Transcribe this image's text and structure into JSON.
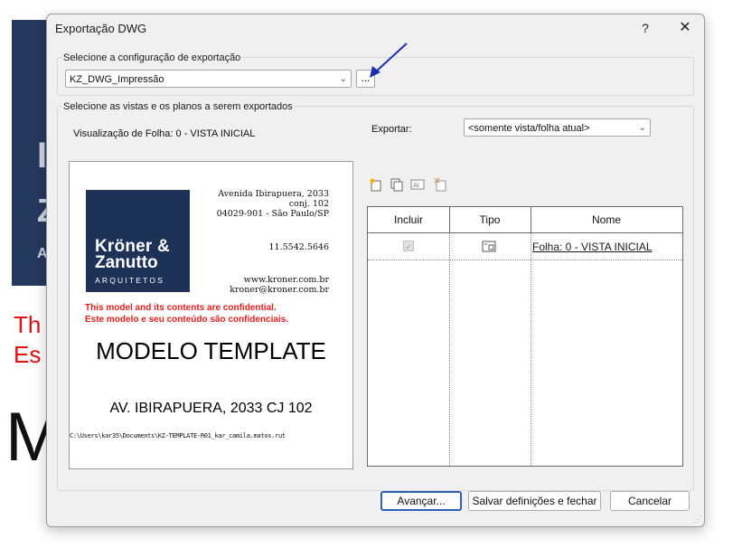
{
  "background": {
    "ghost_letters": [
      "I",
      "Z",
      "A"
    ],
    "red_line1": "Th",
    "red_line2": "Es",
    "big_letter": "M"
  },
  "dialog": {
    "title": "Exportação DWG",
    "help": "?",
    "close": "✕"
  },
  "export_config": {
    "group_label": "Selecione a configuração de exportação",
    "selected": "KZ_DWG_Impressão",
    "more_button": "..."
  },
  "views": {
    "group_label": "Selecione as vistas e os planos a serem exportados",
    "sheet_view_label": "Visualização de Folha: 0 - VISTA INICIAL",
    "export_label": "Exportar:",
    "export_selected": "<somente vista/folha atual>"
  },
  "preview": {
    "logo_line1": "Kröner &",
    "logo_line2": "Zanutto",
    "logo_line3": "ARQUITETOS",
    "address_lines": [
      "Avenida Ibirapuera, 2033",
      "conj. 102",
      "04029-901 - São Paulo/SP"
    ],
    "phone": "11.5542.5646",
    "web_lines": [
      "www.kroner.com.br",
      "kroner@kroner.com.br"
    ],
    "confidential_en": "This model and its contents are confidential.",
    "confidential_pt": "Este modelo e seu conteúdo são confidenciais.",
    "model_title": "MODELO TEMPLATE",
    "street": "AV. IBIRAPUERA, 2033 CJ 102",
    "path": "C:\\Users\\kar35\\Documents\\KZ-TEMPLATE-R01_kar_camila.matos.rut"
  },
  "table": {
    "columns": [
      "Incluir",
      "Tipo",
      "Nome"
    ],
    "rows": [
      {
        "name": "Folha: 0 - VISTA INICIAL",
        "type_icon": "sheet-icon",
        "included": true
      }
    ]
  },
  "buttons": {
    "next": "Avançar...",
    "save_close": "Salvar definições e fechar",
    "cancel": "Cancelar"
  },
  "colors": {
    "accent": "#2b5fb8",
    "logo_bg": "#1e3258",
    "confidential": "#e02020",
    "annotation_arrow": "#1a2fb0"
  }
}
